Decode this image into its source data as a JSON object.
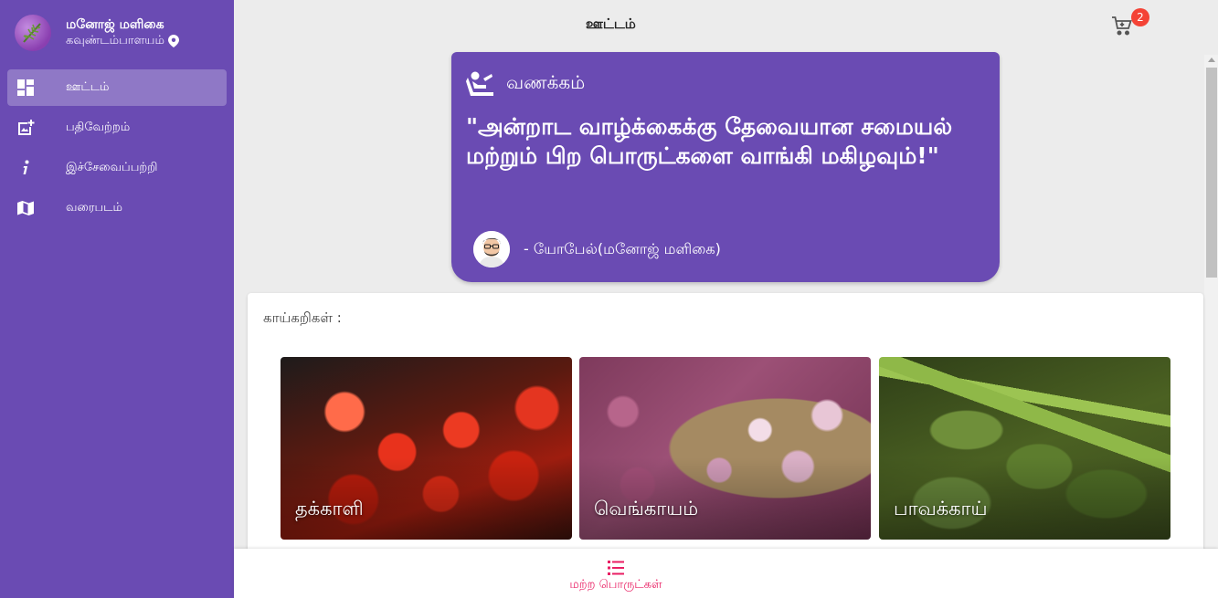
{
  "brand": {
    "name": "மனோஜ் மளிகை",
    "location": "கவுண்டம்பாளயம்"
  },
  "sidebar": {
    "items": [
      {
        "label": "ஊட்டம்",
        "icon": "dashboard-icon",
        "active": true
      },
      {
        "label": "பதிவேற்றம்",
        "icon": "add-photo-icon",
        "active": false
      },
      {
        "label": "இச்சேவைப்பற்றி",
        "icon": "info-icon",
        "active": false
      },
      {
        "label": "வரைபடம்",
        "icon": "map-icon",
        "active": false
      }
    ]
  },
  "topbar": {
    "title": "ஊட்டம்",
    "cart_count": "2"
  },
  "quote": {
    "greeting": "வணக்கம்",
    "text": "\"அன்றாட வாழ்க்கைக்கு தேவையான சமையல் மற்றும் பிற பொருட்களை வாங்கி மகிழவும்!\"",
    "author": "- யோபேல்(மனோஜ் மளிகை)"
  },
  "vegetables": {
    "title": "காய்கறிகள் :",
    "items": [
      {
        "name": "தக்காளி"
      },
      {
        "name": "வெங்காயம்"
      },
      {
        "name": "பாவக்காய்"
      }
    ]
  },
  "bottom_nav": {
    "label": "மற்ற பொருட்கள்"
  },
  "colors": {
    "primary": "#6a4bb3",
    "accent": "#e91e63",
    "badge": "#f44336"
  }
}
